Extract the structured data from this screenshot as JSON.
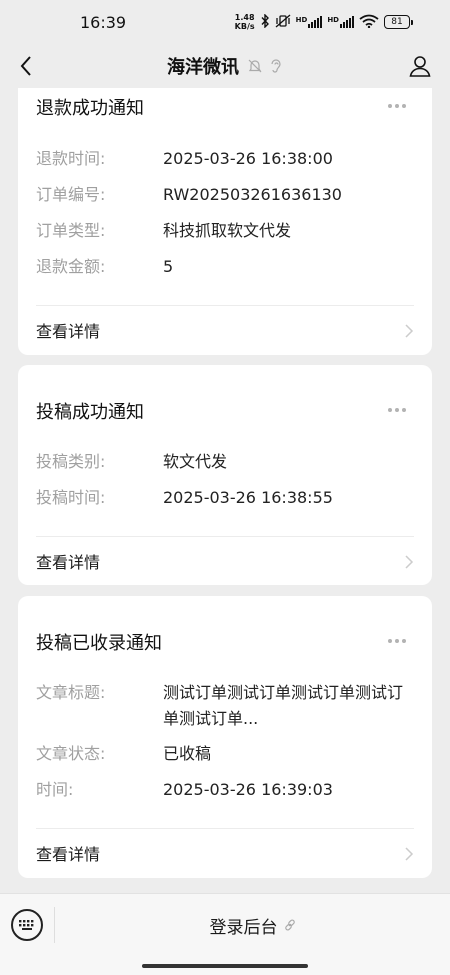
{
  "status_bar": {
    "time": "16:39",
    "net_speed_value": "1.48",
    "net_speed_unit": "KB/s",
    "hd1": "HD",
    "hd2": "HD",
    "battery": "81"
  },
  "nav": {
    "title": "海洋微讯"
  },
  "cards": [
    {
      "title": "退款成功通知",
      "rows": [
        {
          "label": "退款时间:",
          "value": "2025-03-26 16:38:00"
        },
        {
          "label": "订单编号:",
          "value": "RW202503261636130"
        },
        {
          "label": "订单类型:",
          "value": "科技抓取软文代发"
        },
        {
          "label": "退款金额:",
          "value": "5"
        }
      ],
      "link": "查看详情"
    },
    {
      "title": "投稿成功通知",
      "rows": [
        {
          "label": "投稿类别:",
          "value": "软文代发"
        },
        {
          "label": "投稿时间:",
          "value": "2025-03-26 16:38:55"
        }
      ],
      "link": "查看详情"
    },
    {
      "title": "投稿已收录通知",
      "rows": [
        {
          "label": "文章标题:",
          "value": "测试订单测试订单测试订单测试订单测试订单..."
        },
        {
          "label": "文章状态:",
          "value": "已收稿"
        },
        {
          "label": "时间:",
          "value": "2025-03-26 16:39:03"
        }
      ],
      "link": "查看详情"
    }
  ],
  "bottom_bar": {
    "menu_label": "登录后台"
  },
  "colors": {
    "background": "#ededed",
    "card": "#ffffff",
    "label": "#a0a0a0"
  }
}
